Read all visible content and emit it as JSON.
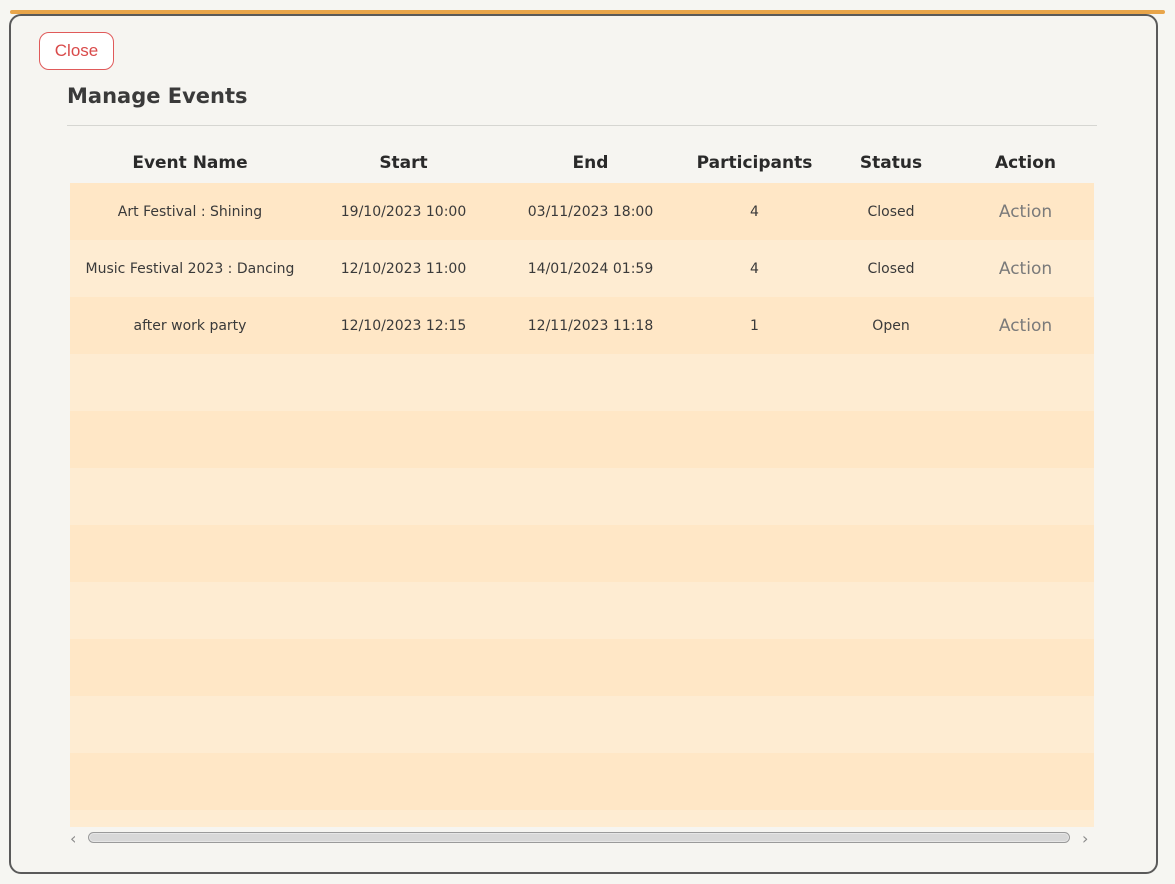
{
  "dialog": {
    "close_label": "Close",
    "title": "Manage Events"
  },
  "table": {
    "columns": [
      "Event Name",
      "Start",
      "End",
      "Participants",
      "Status",
      "Action"
    ],
    "rows": [
      {
        "event_name": "Art Festival : Shining",
        "start": "19/10/2023 10:00",
        "end": "03/11/2023 18:00",
        "participants": "4",
        "status": "Closed",
        "action": "Action"
      },
      {
        "event_name": "Music Festival 2023 : Dancing",
        "start": "12/10/2023 11:00",
        "end": "14/01/2024 01:59",
        "participants": "4",
        "status": "Closed",
        "action": "Action"
      },
      {
        "event_name": "after work party",
        "start": "12/10/2023 12:15",
        "end": "12/11/2023 11:18",
        "participants": "1",
        "status": "Open",
        "action": "Action"
      }
    ]
  },
  "scrollbar": {
    "left_arrow_icon": "chevron-left-icon",
    "right_arrow_icon": "chevron-right-icon"
  },
  "colors": {
    "accent": "#e8a54a",
    "close_button": "#d94a4a",
    "row_background": "#ffe7c6"
  }
}
